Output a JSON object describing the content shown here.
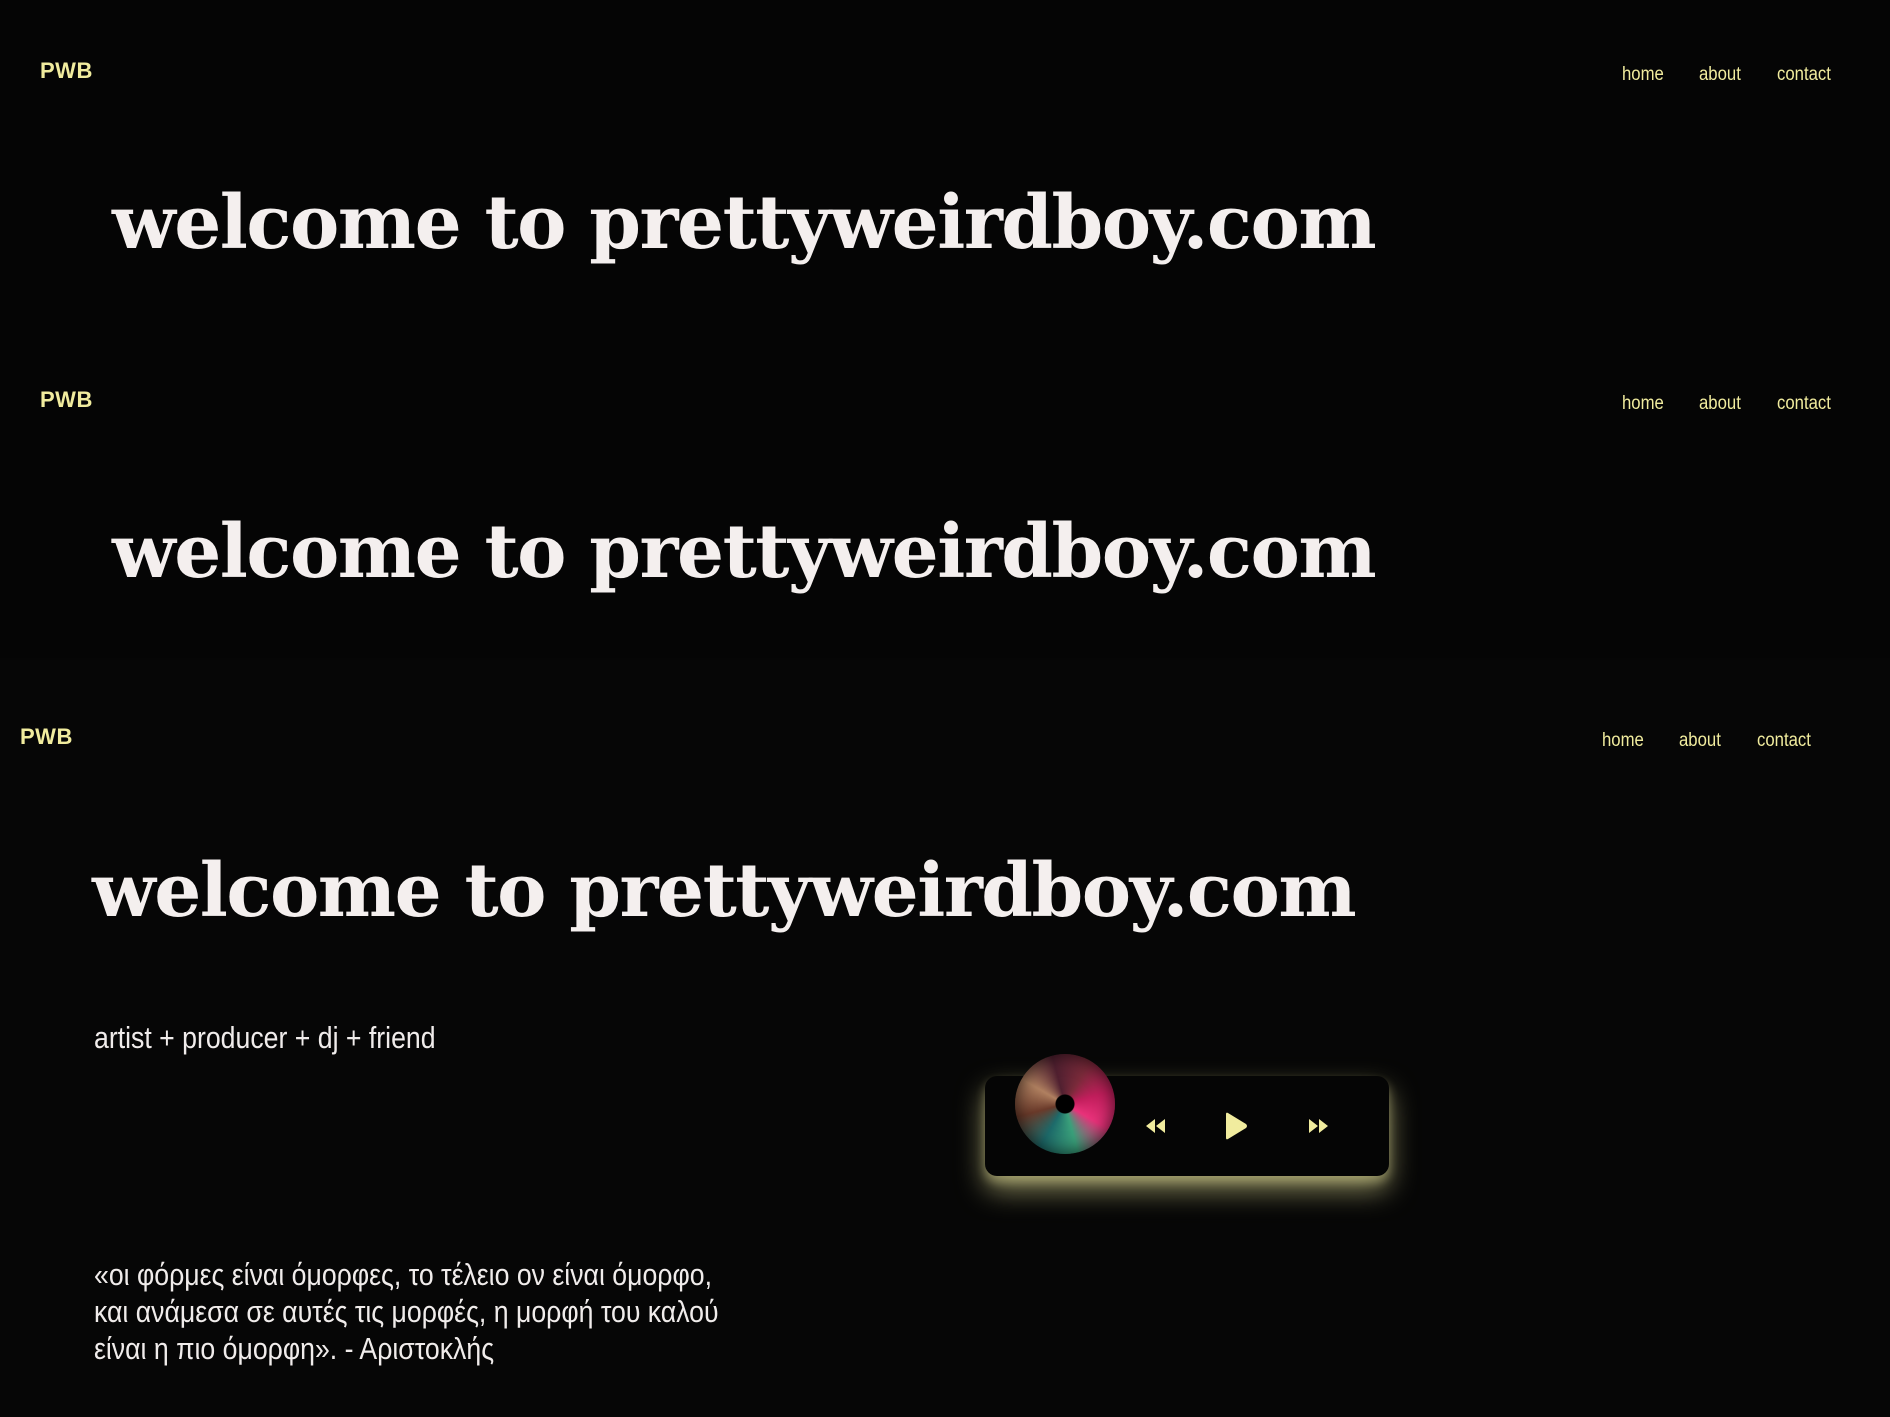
{
  "site": {
    "logo": "PWB",
    "nav": [
      "home",
      "about",
      "contact"
    ],
    "headline": "welcome to prettyweirdboy.com"
  },
  "main": {
    "tagline": "artist + producer + dj + friend",
    "quote_lines": [
      "«οι φόρμες είναι όμορφες, το τέλειο ον είναι όμορφο,",
      "και ανάμεσα σε αυτές τις μορφές, η μορφή του καλού",
      "είναι η πιο όμορφη». - Αριστοκλής"
    ]
  },
  "player": {
    "controls": [
      "rewind-icon",
      "play-icon",
      "fast-forward-icon"
    ],
    "accent_color": "#f1ec9e"
  },
  "colors": {
    "background": "#050505",
    "accent": "#f1ec9e",
    "text": "#f4efee"
  }
}
